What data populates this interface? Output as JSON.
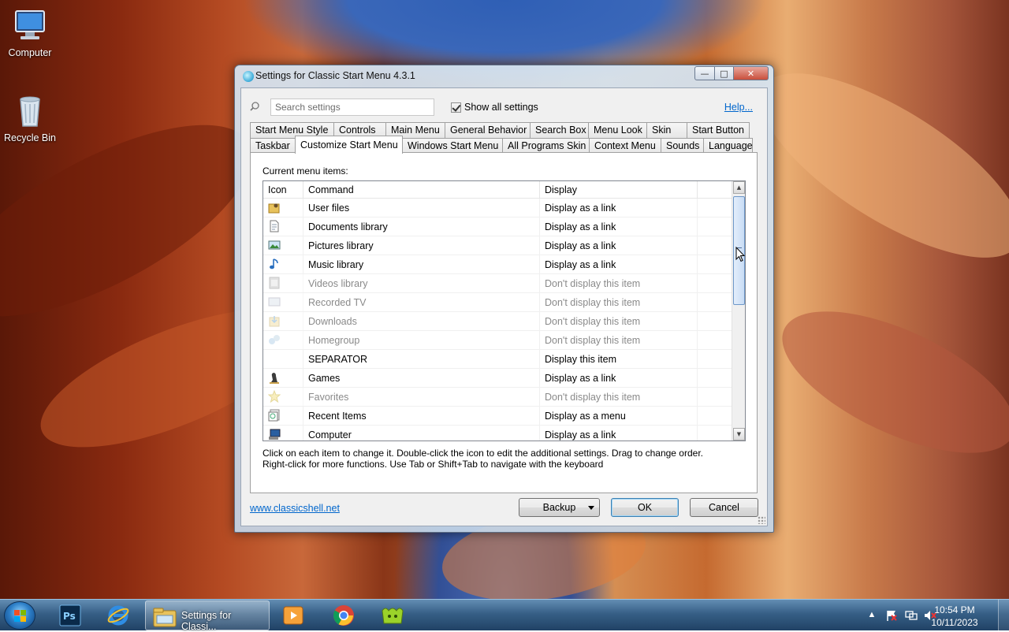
{
  "desktop": {
    "icons": [
      {
        "label": "Computer"
      },
      {
        "label": "Recycle Bin"
      }
    ]
  },
  "window": {
    "title": "Settings for Classic Start Menu 4.3.1",
    "search_placeholder": "Search settings",
    "show_all_label": "Show all settings",
    "help_label": "Help...",
    "tabs_row1": [
      "Start Menu Style",
      "Controls",
      "Main Menu",
      "General Behavior",
      "Search Box",
      "Menu Look",
      "Skin",
      "Start Button"
    ],
    "tabs_row2": [
      "Taskbar",
      "Customize Start Menu",
      "Windows Start Menu",
      "All Programs Skin",
      "Context Menu",
      "Sounds",
      "Language"
    ],
    "active_tab": "Customize Start Menu",
    "current_items_label": "Current menu items:",
    "columns": {
      "icon": "Icon",
      "command": "Command",
      "display": "Display"
    },
    "rows": [
      {
        "icon": "user-folder-icon",
        "command": "User files",
        "display": "Display as a link",
        "dim": false
      },
      {
        "icon": "document-icon",
        "command": "Documents library",
        "display": "Display as a link",
        "dim": false
      },
      {
        "icon": "picture-icon",
        "command": "Pictures library",
        "display": "Display as a link",
        "dim": false
      },
      {
        "icon": "music-note-icon",
        "command": "Music library",
        "display": "Display as a link",
        "dim": false
      },
      {
        "icon": "video-icon",
        "command": "Videos library",
        "display": "Don't display this item",
        "dim": true
      },
      {
        "icon": "tv-icon",
        "command": "Recorded TV",
        "display": "Don't display this item",
        "dim": true
      },
      {
        "icon": "downloads-icon",
        "command": "Downloads",
        "display": "Don't display this item",
        "dim": true
      },
      {
        "icon": "homegroup-icon",
        "command": "Homegroup",
        "display": "Don't display this item",
        "dim": true
      },
      {
        "icon": "",
        "command": "SEPARATOR",
        "display": "Display this item",
        "dim": false
      },
      {
        "icon": "games-icon",
        "command": "Games",
        "display": "Display as a link",
        "dim": false
      },
      {
        "icon": "star-icon",
        "command": "Favorites",
        "display": "Don't display this item",
        "dim": true
      },
      {
        "icon": "recent-items-icon",
        "command": "Recent Items",
        "display": "Display as a menu",
        "dim": false
      },
      {
        "icon": "computer-icon",
        "command": "Computer",
        "display": "Display as a link",
        "dim": false
      }
    ],
    "hint_line1": "Click on each item to change it. Double-click the icon to edit the additional settings. Drag to change order.",
    "hint_line2": "Right-click for more functions. Use Tab or Shift+Tab to navigate with the keyboard",
    "site_link": "www.classicshell.net",
    "backup_label": "Backup",
    "ok_label": "OK",
    "cancel_label": "Cancel"
  },
  "taskbar": {
    "active_window_label": "Settings for Classi...",
    "clock_time": "10:54 PM",
    "clock_date": "10/11/2023"
  }
}
